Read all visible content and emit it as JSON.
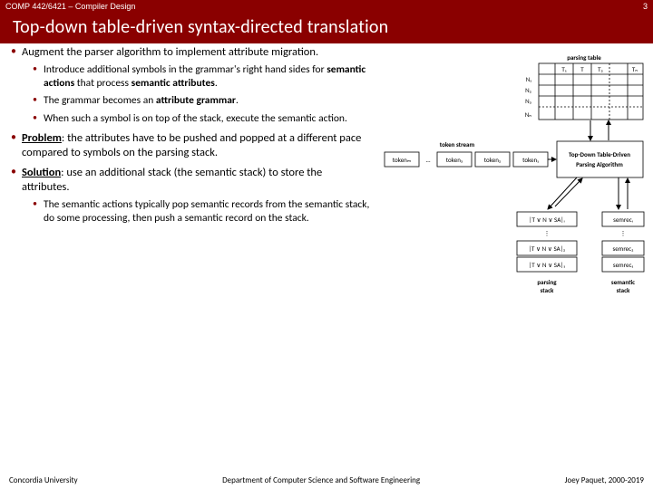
{
  "header": {
    "course": "COMP 442/6421 – Compiler Design",
    "page_num": "3"
  },
  "title": "Top-down table-driven syntax-directed translation",
  "bullets": {
    "b1_pre": "Augment the parser algorithm to implement attribute migration.",
    "b1a_pre": "Introduce additional symbols in the grammar's right hand sides for ",
    "b1a_sa": "semantic actions",
    "b1a_mid": " that process ",
    "b1a_end": "semantic attributes",
    "b1a_dot": ".",
    "b1b_pre": "The grammar becomes an ",
    "b1b_ag": "attribute grammar",
    "b1b_dot": ".",
    "b1c": "When such a symbol is on top of the stack, execute the semantic action.",
    "b2_label": "Problem",
    "b2_body": ": the attributes have to be pushed and popped at a different pace compared to symbols on the parsing stack.",
    "b3_label": "Solution",
    "b3_body": ": use an additional stack (the semantic stack) to store the attributes.",
    "b3a": "The semantic actions typically pop semantic records from the semantic stack, do some processing, then push a semantic record on the stack."
  },
  "diagram": {
    "parsing_table": "parsing table",
    "cols": [
      "T₁",
      "T",
      "T₂",
      "",
      "Tₙ"
    ],
    "rows": [
      "N₁",
      "N₂",
      "N₃",
      "Nₙ"
    ],
    "token_stream": "token stream",
    "tokens": [
      "tokenₘ",
      "token₃",
      "token₂",
      "token₁"
    ],
    "algo_l1": "Top-Down Table-Driven",
    "algo_l2": "Parsing Algorithm",
    "parse_cell": "|T ∨ N ∨ SA|ᵢ",
    "sem_cell": "semrecᵢ",
    "parse_cell2": "|T ∨ N ∨ SA|₂",
    "sem_cell2": "semrec₂",
    "parse_cell1": "|T ∨ N ∨ SA|₁",
    "sem_cell1": "semrec₁",
    "parsing_stack": "parsing\nstack",
    "semantic_stack": "semantic\nstack"
  },
  "footer": {
    "left": "Concordia University",
    "center": "Department of Computer Science and Software Engineering",
    "right": "Joey Paquet, 2000-2019"
  }
}
